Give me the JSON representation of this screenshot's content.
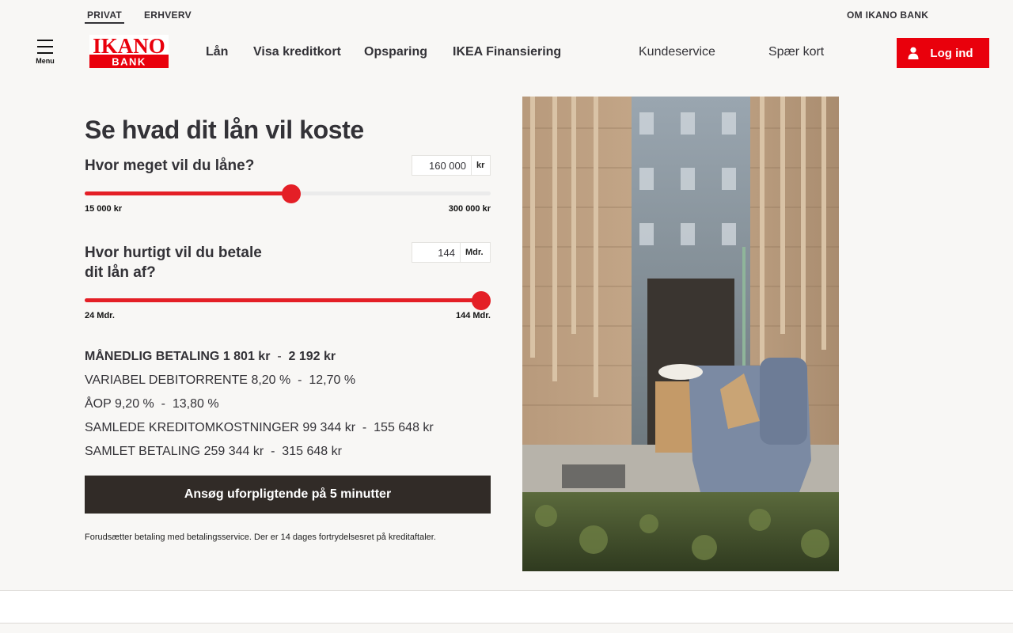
{
  "topbar": {
    "privat": "PRIVAT",
    "erhverv": "ERHVERV",
    "om": "OM IKANO BANK"
  },
  "header": {
    "menu_label": "Menu",
    "logo_line1": "IKANO",
    "logo_line2": "BANK",
    "nav": [
      "Lån",
      "Visa kreditkort",
      "Opsparing",
      "IKEA Finansiering"
    ],
    "kundeservice": "Kundeservice",
    "spaer_kort": "Spær kort",
    "login": "Log ind"
  },
  "calculator": {
    "title": "Se hvad dit lån vil koste",
    "amount": {
      "label": "Hvor meget vil du låne?",
      "value": "160 000",
      "unit": "kr",
      "min_label": "15 000 kr",
      "max_label": "300 000 kr",
      "min": 15000,
      "max": 300000,
      "current": 160000
    },
    "term": {
      "label_line1": "Hvor hurtigt vil du betale",
      "label_line2": "dit lån af?",
      "value": "144",
      "unit": "Mdr.",
      "min_label": "24 Mdr.",
      "max_label": "144 Mdr.",
      "min": 24,
      "max": 144,
      "current": 144
    },
    "results": {
      "monthly_label": "MÅNEDLIG BETALING",
      "monthly_from": "1 801 kr",
      "monthly_to": "2 192 kr",
      "rate_label": "VARIABEL DEBITORRENTE",
      "rate_from": "8,20 %",
      "rate_to": "12,70 %",
      "aop_label": "ÅOP",
      "aop_from": "9,20 %",
      "aop_to": "13,80 %",
      "costs_label": "SAMLEDE KREDITOMKOSTNINGER",
      "costs_from": "99 344 kr",
      "costs_to": "155 648 kr",
      "total_label": "SAMLET BETALING",
      "total_from": "259 344 kr",
      "total_to": "315 648 kr",
      "separator": "-"
    },
    "apply": "Ansøg uforpligtende på 5 minutter",
    "disclaimer": "Forudsætter betaling med betalingsservice. Der er 14 dages fortrydelsesret på kreditaftaler."
  },
  "colors": {
    "brand_red": "#e9000c",
    "slider_red": "#e41f26",
    "dark_button": "#312b27",
    "text": "#333237"
  }
}
